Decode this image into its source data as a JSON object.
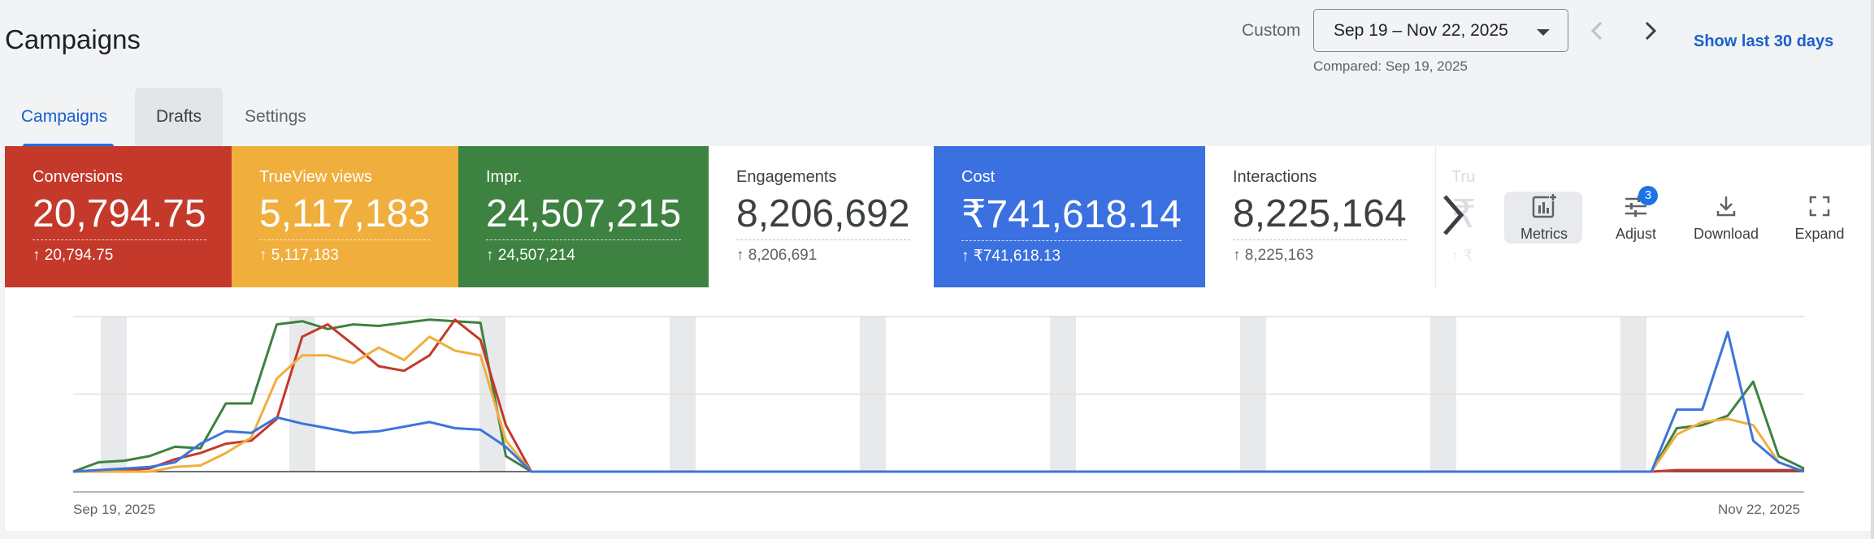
{
  "page": {
    "title": "Campaigns"
  },
  "date": {
    "label": "Custom",
    "range": "Sep 19 – Nov 22, 2025",
    "compared": "Compared: Sep 19, 2025",
    "show_last": "Show last 30 days"
  },
  "tabs": [
    {
      "label": "Campaigns",
      "active": true
    },
    {
      "label": "Drafts",
      "active": false
    },
    {
      "label": "Settings",
      "active": false
    }
  ],
  "scorecards": [
    {
      "name": "Conversions",
      "value": "20,794.75",
      "delta": "20,794.75",
      "color": "#c5392b"
    },
    {
      "name": "TrueView views",
      "value": "5,117,183",
      "delta": "5,117,183",
      "color": "#f0ae3c"
    },
    {
      "name": "Impr.",
      "value": "24,507,215",
      "delta": "24,507,214",
      "color": "#3d8240"
    },
    {
      "name": "Engagements",
      "value": "8,206,692",
      "delta": "8,206,691",
      "color": "#ffffff"
    },
    {
      "name": "Cost",
      "value": "₹741,618.14",
      "delta": "₹741,618.13",
      "color": "#3a70e0"
    },
    {
      "name": "Interactions",
      "value": "8,225,164",
      "delta": "8,225,163",
      "color": "#ffffff"
    },
    {
      "name": "Tru",
      "value": "₹",
      "delta": "↑ ₹",
      "color": "#ffffff"
    }
  ],
  "toolbar": {
    "metrics": "Metrics",
    "adjust": "Adjust",
    "adjust_badge": "3",
    "download": "Download",
    "expand": "Expand"
  },
  "chart_data": {
    "type": "line",
    "x_start_label": "Sep 19, 2025",
    "x_end_label": "Nov 22, 2025",
    "ylim": [
      0,
      100
    ],
    "grid": true,
    "series": [
      {
        "color": "#3d8240",
        "values": [
          0,
          6,
          7,
          10,
          16,
          15,
          44,
          44,
          95,
          97,
          92,
          95,
          94,
          96,
          98,
          97,
          96,
          10,
          0,
          0,
          0,
          0,
          0,
          0,
          0,
          0,
          0,
          0,
          0,
          0,
          0,
          0,
          0,
          0,
          0,
          0,
          0,
          0,
          0,
          0,
          0,
          0,
          0,
          0,
          0,
          0,
          0,
          0,
          0,
          0,
          0,
          0,
          0,
          0,
          0,
          0,
          0,
          0,
          0,
          0,
          0,
          0,
          0,
          28,
          30,
          36,
          58,
          10,
          2
        ]
      },
      {
        "color": "#c5392b",
        "values": [
          0,
          1,
          1,
          2,
          8,
          12,
          18,
          20,
          34,
          87,
          95,
          82,
          68,
          65,
          75,
          98,
          85,
          30,
          0,
          0,
          0,
          0,
          0,
          0,
          0,
          0,
          0,
          0,
          0,
          0,
          0,
          0,
          0,
          0,
          0,
          0,
          0,
          0,
          0,
          0,
          0,
          0,
          0,
          0,
          0,
          0,
          0,
          0,
          0,
          0,
          0,
          0,
          0,
          0,
          0,
          0,
          0,
          0,
          0,
          0,
          0,
          0,
          0,
          1,
          1,
          1,
          1,
          1,
          1
        ]
      },
      {
        "color": "#f0ae3c",
        "values": [
          0,
          0,
          0,
          0,
          3,
          4,
          12,
          22,
          60,
          75,
          75,
          70,
          80,
          72,
          87,
          78,
          75,
          20,
          0,
          0,
          0,
          0,
          0,
          0,
          0,
          0,
          0,
          0,
          0,
          0,
          0,
          0,
          0,
          0,
          0,
          0,
          0,
          0,
          0,
          0,
          0,
          0,
          0,
          0,
          0,
          0,
          0,
          0,
          0,
          0,
          0,
          0,
          0,
          0,
          0,
          0,
          0,
          0,
          0,
          0,
          0,
          0,
          0,
          24,
          32,
          34,
          30,
          6,
          0
        ]
      },
      {
        "color": "#3c74db",
        "values": [
          0,
          1,
          2,
          3,
          6,
          18,
          26,
          25,
          35,
          31,
          28,
          25,
          26,
          29,
          32,
          28,
          27,
          16,
          0,
          0,
          0,
          0,
          0,
          0,
          0,
          0,
          0,
          0,
          0,
          0,
          0,
          0,
          0,
          0,
          0,
          0,
          0,
          0,
          0,
          0,
          0,
          0,
          0,
          0,
          0,
          0,
          0,
          0,
          0,
          0,
          0,
          0,
          0,
          0,
          0,
          0,
          0,
          0,
          0,
          0,
          0,
          0,
          0,
          40,
          40,
          90,
          20,
          6,
          0
        ]
      }
    ]
  }
}
